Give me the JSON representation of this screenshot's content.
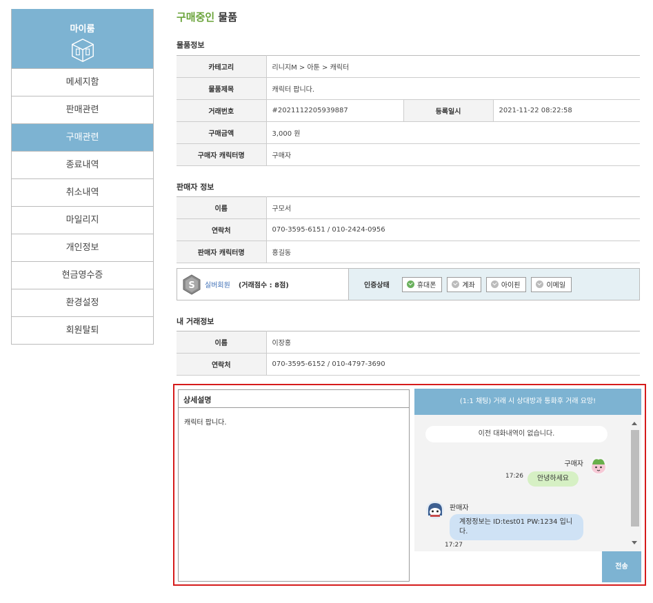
{
  "sidebar": {
    "title": "마이룸",
    "items": [
      {
        "label": "메세지함"
      },
      {
        "label": "판매관련"
      },
      {
        "label": "구매관련"
      },
      {
        "label": "종료내역"
      },
      {
        "label": "취소내역"
      },
      {
        "label": "마일리지"
      },
      {
        "label": "개인정보"
      },
      {
        "label": "현금영수증"
      },
      {
        "label": "환경설정"
      },
      {
        "label": "회원탈퇴"
      }
    ],
    "active": "구매관련"
  },
  "page": {
    "title_accent": "구매중인",
    "title_rest": " 물품"
  },
  "product": {
    "section": "물품정보",
    "category_label": "카테고리",
    "category_value": "리니지M > 아툰 > 캐릭터",
    "name_label": "물품제목",
    "name_value": "캐릭터 팝니다.",
    "trade_no_label": "거래번호",
    "trade_no_value": "#2021112205939887",
    "reg_date_label": "등록일시",
    "reg_date_value": "2021-11-22 08:22:58",
    "price_label": "구매금액",
    "price_value": "3,000 원",
    "buyer_char_label": "구매자 캐릭터명",
    "buyer_char_value": "구매자"
  },
  "seller": {
    "section": "판매자 정보",
    "name_label": "이름",
    "name_value": "구모서",
    "contact_label": "연락처",
    "contact_value": "070-3595-6151 / 010-2424-0956",
    "char_label": "판매자 캐릭터명",
    "char_value": "홍길동",
    "grade": "실버회원",
    "score": "(거래점수 : 8점)",
    "verify_label": "인증상태",
    "verify": [
      {
        "label": "휴대폰",
        "status": "verified"
      },
      {
        "label": "계좌",
        "status": "unverified"
      },
      {
        "label": "아이핀",
        "status": "unverified"
      },
      {
        "label": "이메일",
        "status": "unverified"
      }
    ]
  },
  "mine": {
    "section": "내 거래정보",
    "name_label": "이름",
    "name_value": "이장홍",
    "contact_label": "연락처",
    "contact_value": "070-3595-6152 / 010-4797-3690"
  },
  "detail": {
    "title": "상세설명",
    "body": "캐릭터 팝니다."
  },
  "chat": {
    "header": "(1:1 채팅) 거래 시 상대방과 통화후 거래 요망!",
    "notice": "이전 대화내역이 없습니다.",
    "buyer_name": "구매자",
    "buyer_time": "17:26",
    "buyer_msg": "안녕하세요",
    "seller_name": "판매자",
    "seller_msg": "계정정보는 ID:test01 PW:1234 입니다.",
    "seller_time": "17:27",
    "send_label": "전송"
  },
  "colors": {
    "accent": "#7db3d2",
    "title_accent": "#6aa33a",
    "highlight_border": "#d51a1a"
  }
}
